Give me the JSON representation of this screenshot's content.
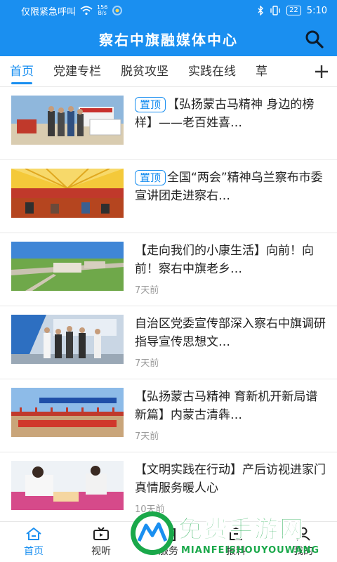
{
  "status_bar": {
    "carrier_text": "仅限紧急呼叫",
    "net_speed_value": "156",
    "net_speed_unit": "B/s",
    "battery": "22",
    "time": "5:10"
  },
  "header": {
    "title": "察右中旗融媒体中心",
    "search_icon": "search-icon"
  },
  "tabs": [
    {
      "label": "首页",
      "active": true
    },
    {
      "label": "党建专栏"
    },
    {
      "label": "脱贫攻坚"
    },
    {
      "label": "实践在线"
    },
    {
      "label": "草"
    }
  ],
  "tabs_add_icon": "plus-icon",
  "pin_label": "置顶",
  "news": [
    {
      "pinned": true,
      "title": "【弘扬蒙古马精神 身边的榜样】——老百姓喜…",
      "time": ""
    },
    {
      "pinned": true,
      "title": "全国“两会”精神乌兰察布市委宣讲团走进察右…",
      "time": ""
    },
    {
      "pinned": false,
      "title": "【走向我们的小康生活】向前！向前！察右中旗老乡…",
      "time": "7天前"
    },
    {
      "pinned": false,
      "title": "自治区党委宣传部深入察右中旗调研指导宣传思想文…",
      "time": "7天前"
    },
    {
      "pinned": false,
      "title": "【弘扬蒙古马精神 育新机开新局谱新篇】内蒙古清犇…",
      "time": "7天前"
    },
    {
      "pinned": false,
      "title": "【文明实践在行动】产后访视进家门 真情服务暖人心",
      "time": "10天前"
    }
  ],
  "bottom_nav": [
    {
      "label": "首页",
      "icon": "home-icon",
      "active": true
    },
    {
      "label": "视听",
      "icon": "tv-icon"
    },
    {
      "label": "服务",
      "icon": "service-icon"
    },
    {
      "label": "报料",
      "icon": "report-icon"
    },
    {
      "label": "我的",
      "icon": "user-icon"
    }
  ],
  "watermark": {
    "text": "免费手游网",
    "sub": "MIANFEISHOUYOUWANG"
  },
  "colors": {
    "primary": "#1a8ff0",
    "watermark": "#1aa84a"
  }
}
